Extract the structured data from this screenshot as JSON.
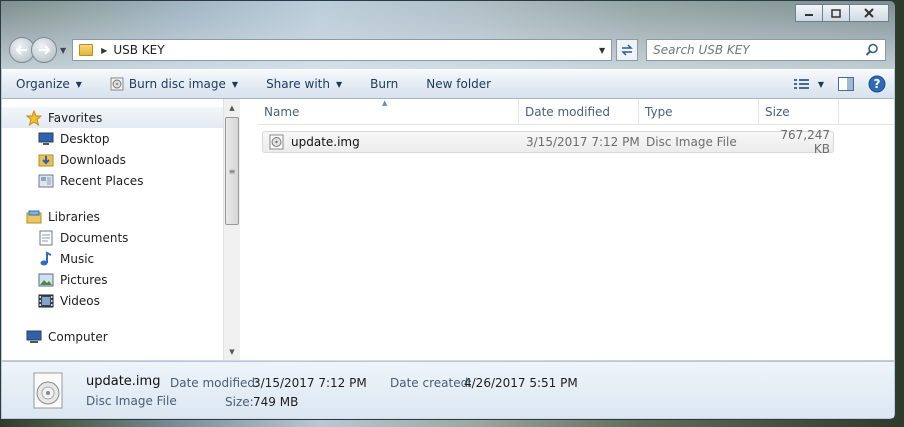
{
  "window": {
    "caption_buttons": [
      "minimize",
      "maximize",
      "close"
    ]
  },
  "address": {
    "path": "USB KEY",
    "search_placeholder": "Search USB KEY"
  },
  "toolbar": {
    "organize": "Organize",
    "burn_disc_image": "Burn disc image",
    "share_with": "Share with",
    "burn": "Burn",
    "new_folder": "New folder"
  },
  "navigation": {
    "favorites": {
      "label": "Favorites",
      "items": [
        "Desktop",
        "Downloads",
        "Recent Places"
      ]
    },
    "libraries": {
      "label": "Libraries",
      "items": [
        "Documents",
        "Music",
        "Pictures",
        "Videos"
      ]
    },
    "computer": "Computer"
  },
  "columns": {
    "name": "Name",
    "date_modified": "Date modified",
    "type": "Type",
    "size": "Size"
  },
  "files": [
    {
      "name": "update.img",
      "date_modified": "3/15/2017 7:12 PM",
      "type": "Disc Image File",
      "size": "767,247 KB"
    }
  ],
  "details": {
    "name": "update.img",
    "type": "Disc Image File",
    "date_modified_label": "Date modified:",
    "date_modified": "3/15/2017 7:12 PM",
    "date_created_label": "Date created:",
    "date_created": "4/26/2017 5:51 PM",
    "size_label": "Size:",
    "size": "749 MB"
  },
  "colors": {
    "toolbar_text": "#1e395b",
    "header_text": "#4c607a",
    "secondary_text": "#6d6d6d"
  }
}
